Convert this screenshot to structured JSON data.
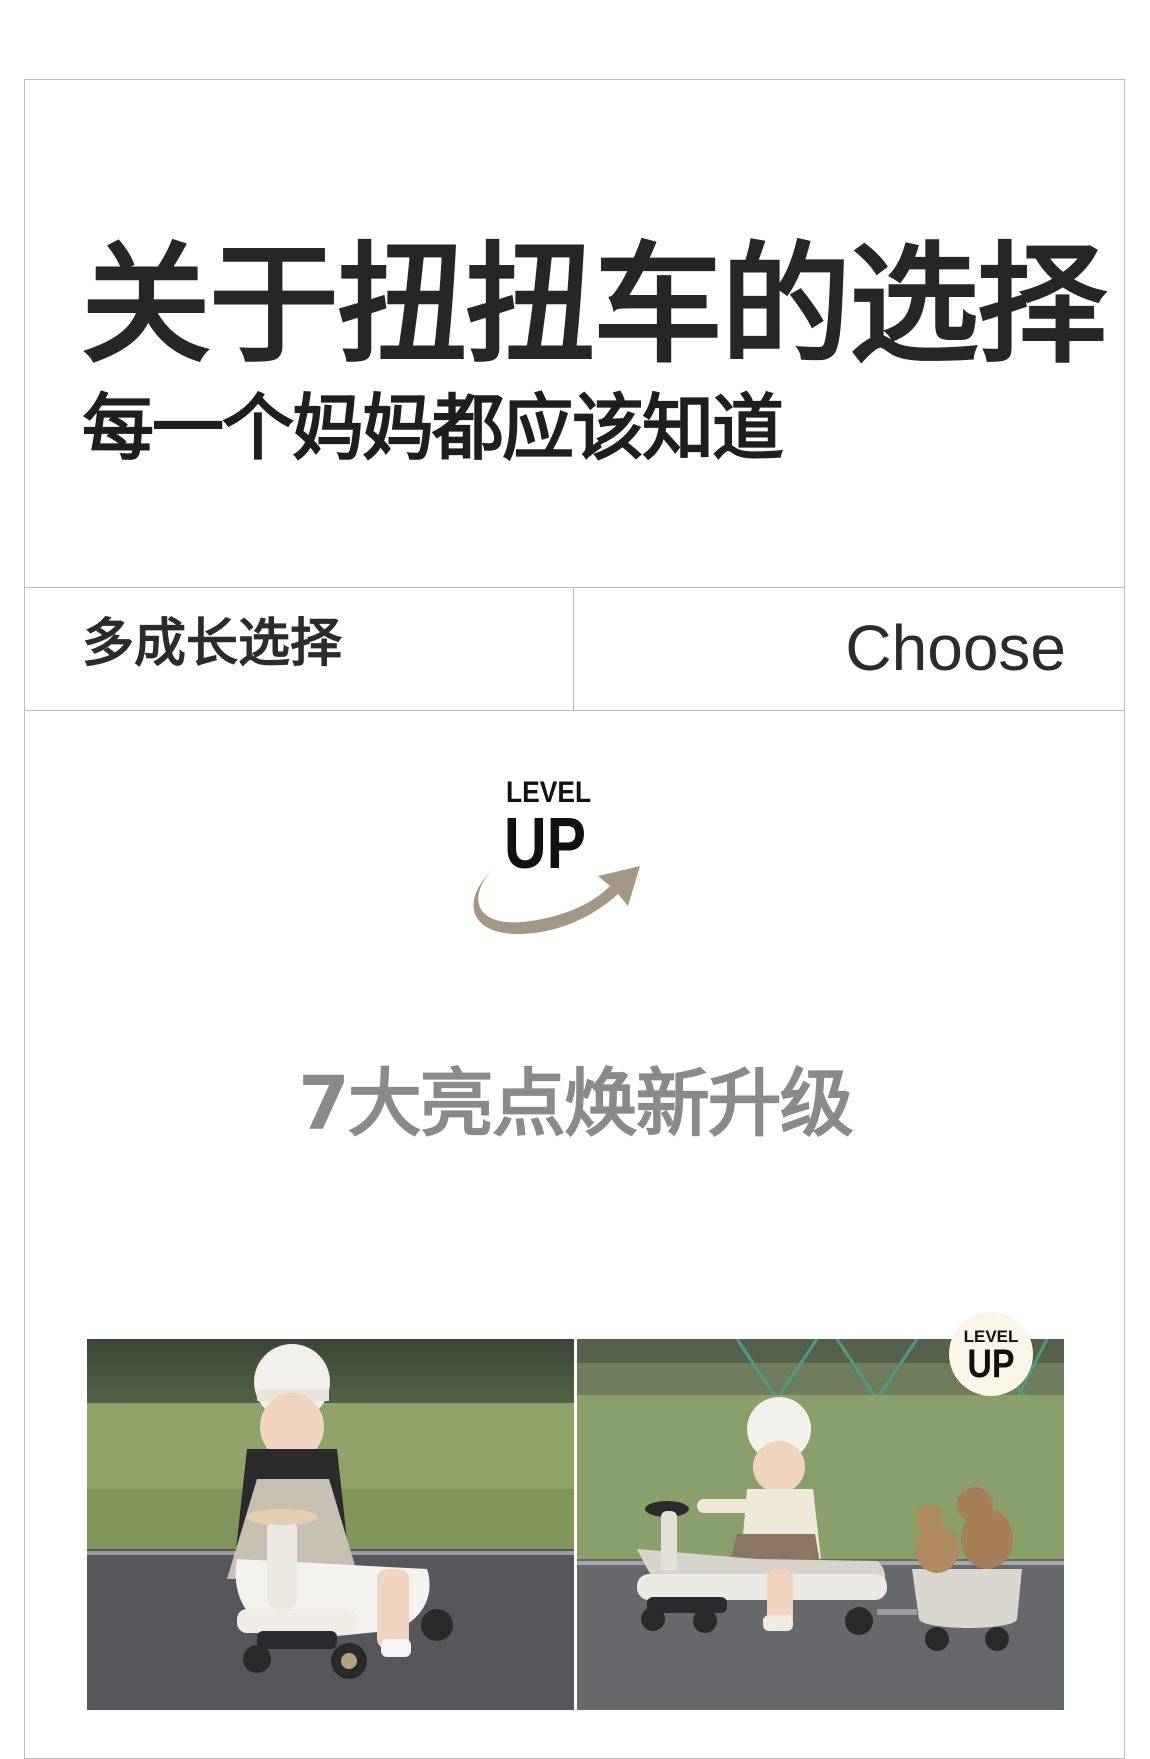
{
  "header": {
    "title": "关于扭扭车的选择",
    "subtitle": "每一个妈妈都应该知道"
  },
  "choose_row": {
    "left_label": "多成长选择",
    "right_label": "Choose"
  },
  "level_up_logo": {
    "level_text": "LEVEL",
    "up_text": "UP",
    "arrow_color": "#a39884"
  },
  "highlights": {
    "headline": "7大亮点焕新升级"
  },
  "photos": {
    "left": {
      "icon": "child-on-swing-car-photo"
    },
    "right": {
      "icon": "child-on-swing-car-with-trailer-photo",
      "badge": {
        "level_text": "LEVEL",
        "up_text": "UP"
      }
    }
  },
  "colors": {
    "border": "#bdbdbd",
    "title": "#262626",
    "headline_gray": "#8a8a8a",
    "badge_bg": "#fbf6e8"
  }
}
